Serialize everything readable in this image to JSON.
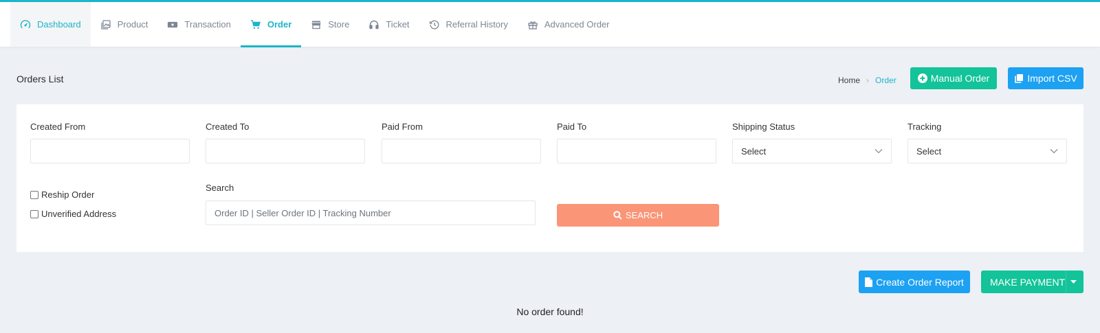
{
  "nav": {
    "items": [
      {
        "label": "Dashboard",
        "icon": "dashboard-gauge-icon"
      },
      {
        "label": "Product",
        "icon": "product-gallery-icon"
      },
      {
        "label": "Transaction",
        "icon": "cash-icon"
      },
      {
        "label": "Order",
        "icon": "cart-icon"
      },
      {
        "label": "Store",
        "icon": "store-icon"
      },
      {
        "label": "Ticket",
        "icon": "headset-icon"
      },
      {
        "label": "Referral History",
        "icon": "history-icon"
      },
      {
        "label": "Advanced Order",
        "icon": "gift-icon"
      }
    ],
    "active": "Order"
  },
  "header": {
    "title": "Orders List",
    "breadcrumb": {
      "home": "Home",
      "current": "Order"
    },
    "manual_order_label": "Manual Order",
    "import_csv_label": "Import CSV"
  },
  "filters": {
    "created_from": {
      "label": "Created From",
      "value": ""
    },
    "created_to": {
      "label": "Created To",
      "value": ""
    },
    "paid_from": {
      "label": "Paid From",
      "value": ""
    },
    "paid_to": {
      "label": "Paid To",
      "value": ""
    },
    "shipping_status": {
      "label": "Shipping Status",
      "value": "Select"
    },
    "tracking": {
      "label": "Tracking",
      "value": "Select"
    },
    "reship_order": {
      "label": "Reship Order",
      "checked": false
    },
    "unverified_address": {
      "label": "Unverified Address",
      "checked": false
    },
    "search": {
      "label": "Search",
      "placeholder": "Order ID | Seller Order ID | Tracking Number",
      "value": ""
    },
    "search_button_label": "SEARCH"
  },
  "actions": {
    "create_report_label": "Create Order Report",
    "make_payment_label": "MAKE PAYMENT"
  },
  "results": {
    "empty_message": "No order found!"
  },
  "colors": {
    "accent": "#1cb5c9",
    "green": "#13c399",
    "blue": "#1da1f2",
    "search_orange": "#fa9577",
    "background": "#edf0f5"
  }
}
